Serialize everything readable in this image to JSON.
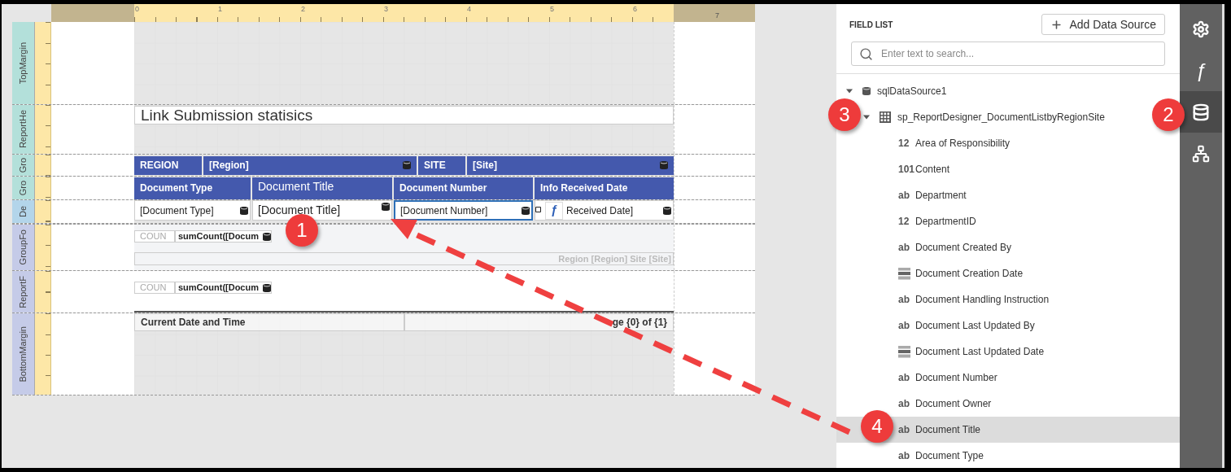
{
  "ruler": {
    "marks": [
      "0",
      "1",
      "2",
      "3",
      "4",
      "5",
      "6",
      "7"
    ]
  },
  "bands": [
    {
      "kind": "top_margin",
      "label": "TopMargin",
      "color": "#b3e0da"
    },
    {
      "kind": "report_header",
      "label": "ReportHe",
      "color": "#b3e0da",
      "title": "Link Submission statisics"
    },
    {
      "kind": "group_header",
      "label": "Gro",
      "color": "#b3e0da",
      "cells": [
        {
          "text": "REGION",
          "bound": false
        },
        {
          "text": "[Region]",
          "bound": true
        },
        {
          "text": "SITE",
          "bound": false
        },
        {
          "text": "[Site]",
          "bound": true
        }
      ]
    },
    {
      "kind": "column_header",
      "label": "Gro",
      "color": "#b3e0da",
      "cells": [
        {
          "text": "Document Type",
          "bold": true,
          "large": false
        },
        {
          "text": "Document Title",
          "bold": false,
          "large": true
        },
        {
          "text": "Document Number",
          "bold": true,
          "large": false
        },
        {
          "text": "Info Received Date",
          "bold": true,
          "large": false
        }
      ]
    },
    {
      "kind": "detail",
      "label": "De",
      "color": "#b3d5ea",
      "cells": [
        {
          "text": "[Document Type]",
          "large": false,
          "selected": false
        },
        {
          "text": "[Document Title]",
          "large": true,
          "selected": false
        },
        {
          "text": "[Document Number]",
          "large": false,
          "selected": true
        },
        {
          "text": "Received Date]",
          "large": false,
          "selected": false,
          "glyph": "ƒ"
        }
      ]
    },
    {
      "kind": "group_footer",
      "label": "GroupFo",
      "color": "#c5cbe8",
      "summary": {
        "label": "COUN",
        "value": "sumCount([Docum"
      },
      "caption": "Region [Region] Site [Site]"
    },
    {
      "kind": "report_footer",
      "label": "ReportF",
      "color": "#c5cbe8",
      "summary": {
        "label": "COUN",
        "value": "sumCount([Docum"
      }
    },
    {
      "kind": "bottom_margin",
      "label": "BottomMargin",
      "color": "#c5cbe8",
      "cells": [
        "Current Date and Time",
        "ge {0} of {1}"
      ]
    }
  ],
  "field_list": {
    "title": "FIELD LIST",
    "add_button": "Add Data Source",
    "search_placeholder": "Enter text to search...",
    "tree": [
      {
        "label": "sqlDataSource1",
        "kind": "source",
        "expanded": true,
        "selected": false,
        "children": [
          {
            "label": "sp_ReportDesigner_DocumentListbyRegionSite",
            "kind": "table",
            "expanded": true,
            "selected": false,
            "children": [
              {
                "label": "Area of Responsibility",
                "kind": "number",
                "type_label": "12",
                "selected": false
              },
              {
                "label": "Content",
                "kind": "memo",
                "type_label": "101",
                "selected": false
              },
              {
                "label": "Department",
                "kind": "text",
                "type_label": "ab",
                "selected": false
              },
              {
                "label": "DepartmentID",
                "kind": "number",
                "type_label": "12",
                "selected": false
              },
              {
                "label": "Document Created By",
                "kind": "text",
                "type_label": "ab",
                "selected": false
              },
              {
                "label": "Document Creation Date",
                "kind": "date",
                "selected": false
              },
              {
                "label": "Document Handling Instruction",
                "kind": "text",
                "type_label": "ab",
                "selected": false
              },
              {
                "label": "Document Last Updated By",
                "kind": "text",
                "type_label": "ab",
                "selected": false
              },
              {
                "label": "Document Last Updated Date",
                "kind": "date",
                "selected": false
              },
              {
                "label": "Document Number",
                "kind": "text",
                "type_label": "ab",
                "selected": false
              },
              {
                "label": "Document Owner",
                "kind": "text",
                "type_label": "ab",
                "selected": false
              },
              {
                "label": "Document Title",
                "kind": "text",
                "type_label": "ab",
                "selected": true
              },
              {
                "label": "Document Type",
                "kind": "text",
                "type_label": "ab",
                "selected": false
              }
            ]
          }
        ]
      }
    ]
  },
  "sidebar": [
    {
      "kind": "settings",
      "selected": false
    },
    {
      "kind": "functions",
      "glyph": "ƒ",
      "selected": false
    },
    {
      "kind": "data",
      "selected": true
    },
    {
      "kind": "structure",
      "selected": false
    }
  ],
  "callouts": [
    {
      "label": "1"
    },
    {
      "label": "2"
    },
    {
      "label": "3"
    },
    {
      "label": "4"
    }
  ]
}
